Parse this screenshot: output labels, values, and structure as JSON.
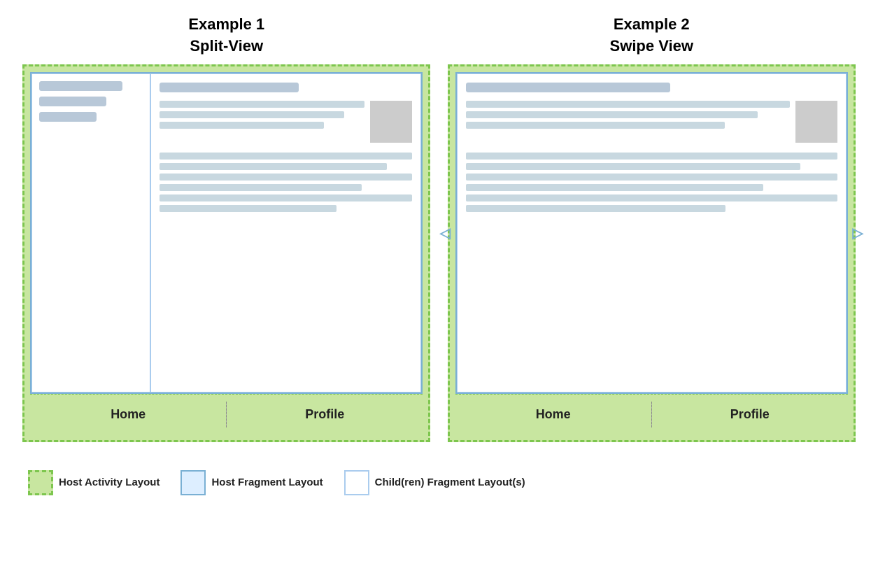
{
  "example1": {
    "title_line1": "Example 1",
    "title_line2": "Split-View",
    "tab_home": "Home",
    "tab_profile": "Profile"
  },
  "example2": {
    "title_line1": "Example 2",
    "title_line2": "Swipe View",
    "tab_home": "Home",
    "tab_profile": "Profile"
  },
  "legend": {
    "item1": "Host Activity Layout",
    "item2": "Host Fragment Layout",
    "item3": "Child(ren) Fragment Layout(s)"
  },
  "arrows": {
    "left": "◁",
    "right": "▷"
  }
}
